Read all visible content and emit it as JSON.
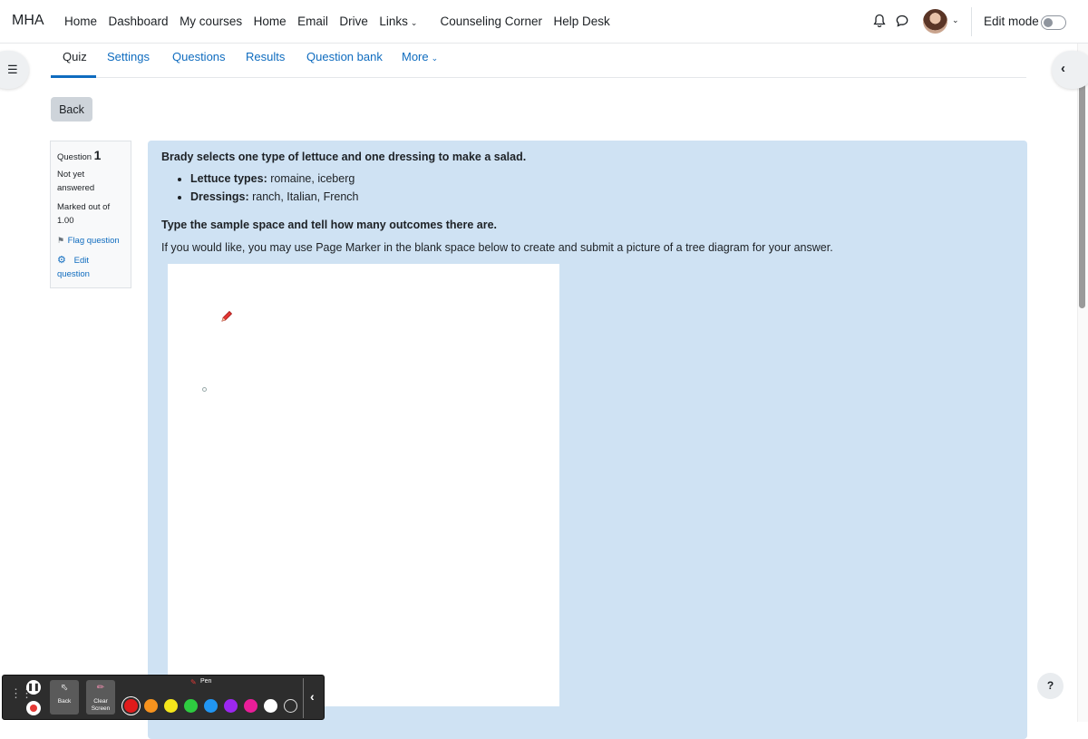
{
  "navbar": {
    "brand": "MHA",
    "links": [
      {
        "label": "Home"
      },
      {
        "label": "Dashboard"
      },
      {
        "label": "My courses"
      },
      {
        "label": "Home"
      },
      {
        "label": "Email"
      },
      {
        "label": "Drive"
      },
      {
        "label": "Links",
        "dropdown": true
      },
      {
        "label": "Counseling Corner"
      },
      {
        "label": "Help Desk"
      }
    ],
    "edit_mode_label": "Edit mode",
    "edit_mode_on": false
  },
  "tabs": [
    {
      "label": "Quiz",
      "active": true
    },
    {
      "label": "Settings"
    },
    {
      "label": "Questions"
    },
    {
      "label": "Results"
    },
    {
      "label": "Question bank"
    },
    {
      "label": "More",
      "dropdown": true
    }
  ],
  "back_label": "Back",
  "question_info": {
    "label": "Question",
    "number": "1",
    "state_line1": "Not yet",
    "state_line2": "answered",
    "marks_line1": "Marked out of",
    "marks_line2": "1.00",
    "flag_label": "Flag question",
    "edit_line1": "Edit",
    "edit_line2": "question"
  },
  "question": {
    "title": "Brady selects one type of lettuce and one dressing to make a salad.",
    "items": [
      {
        "term": "Lettuce types:",
        "value": " romaine, iceberg"
      },
      {
        "term": "Dressings:",
        "value": " ranch, Italian, French"
      }
    ],
    "prompt": "Type the sample space and tell how many outcomes there are.",
    "hint": "If you would like, you may use Page Marker in the blank space below to create and submit a picture of a tree diagram for your answer."
  },
  "help_label": "?",
  "page_marker": {
    "back_label": "Back",
    "clear_line1": "Clear",
    "clear_line2": "Screen",
    "pen_label": "Pen",
    "colors": [
      "#e01b1b",
      "#f7931e",
      "#f5e61b",
      "#2ecc40",
      "#2196f3",
      "#9c27f0",
      "#e91e99",
      "#ffffff",
      "#2d2d2d"
    ]
  }
}
